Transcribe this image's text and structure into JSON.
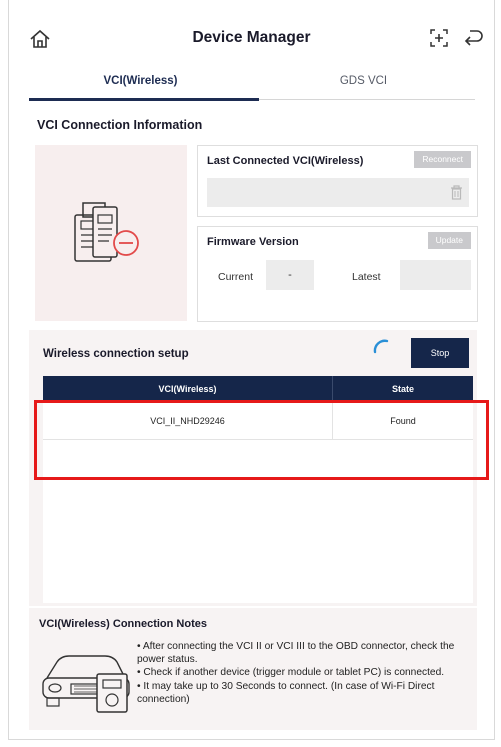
{
  "header": {
    "title": "Device Manager",
    "icons": [
      "home-icon",
      "add-device-icon",
      "back-icon"
    ]
  },
  "tabs": [
    {
      "label": "VCI(Wireless)",
      "active": true
    },
    {
      "label": "GDS VCI",
      "active": false
    }
  ],
  "connection_info": {
    "title": "VCI Connection Information",
    "last_connected": {
      "label": "Last Connected VCI(Wireless)",
      "button": "Reconnect",
      "value": ""
    },
    "firmware": {
      "label": "Firmware Version",
      "button": "Update",
      "current_label": "Current",
      "current_value": "-",
      "latest_label": "Latest",
      "latest_value": ""
    }
  },
  "wireless_setup": {
    "title": "Wireless connection setup",
    "stop_button": "Stop",
    "columns": [
      "VCI(Wireless)",
      "State"
    ],
    "rows": [
      {
        "vci": "VCI_II_NHD29246",
        "state": "Found"
      }
    ]
  },
  "notes": {
    "title": "VCI(Wireless) Connection Notes",
    "items": [
      "• After connecting the VCI II or VCI III to the OBD connector, check the power status.",
      "• Check if another device (trigger module or tablet PC) is connected.",
      "• It may take up to 30 Seconds to connect. (In case of Wi-Fi Direct connection)"
    ]
  },
  "colors": {
    "navy": "#15264a",
    "highlight": "#e61919",
    "panel_bg": "#f7f3f3"
  }
}
